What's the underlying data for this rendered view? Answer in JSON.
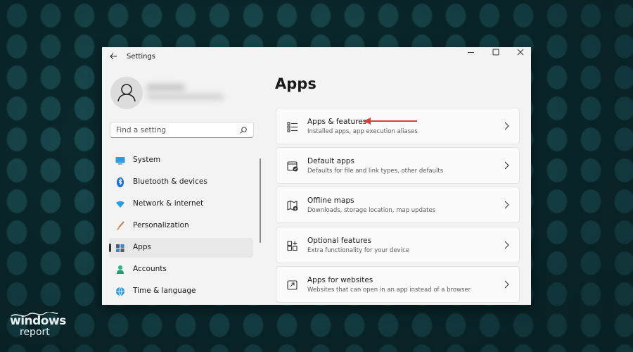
{
  "window": {
    "title": "Settings",
    "controls": {
      "minimize": "minimize-icon",
      "maximize": "maximize-icon",
      "close": "close-icon"
    }
  },
  "search": {
    "placeholder": "Find a setting"
  },
  "sidebar": {
    "items": [
      {
        "label": "System",
        "icon": "system-icon",
        "active": false
      },
      {
        "label": "Bluetooth & devices",
        "icon": "bluetooth-icon",
        "active": false
      },
      {
        "label": "Network & internet",
        "icon": "wifi-icon",
        "active": false
      },
      {
        "label": "Personalization",
        "icon": "brush-icon",
        "active": false
      },
      {
        "label": "Apps",
        "icon": "apps-icon",
        "active": true
      },
      {
        "label": "Accounts",
        "icon": "accounts-icon",
        "active": false
      },
      {
        "label": "Time & language",
        "icon": "globe-icon",
        "active": false
      }
    ]
  },
  "main": {
    "title": "Apps",
    "cards": [
      {
        "title": "Apps & features",
        "subtitle": "Installed apps, app execution aliases",
        "icon": "apps-list-icon"
      },
      {
        "title": "Default apps",
        "subtitle": "Defaults for file and link types, other defaults",
        "icon": "default-apps-icon"
      },
      {
        "title": "Offline maps",
        "subtitle": "Downloads, storage location, map updates",
        "icon": "map-icon"
      },
      {
        "title": "Optional features",
        "subtitle": "Extra functionality for your device",
        "icon": "optional-features-icon"
      },
      {
        "title": "Apps for websites",
        "subtitle": "Websites that can open in an app instead of a browser",
        "icon": "open-in-app-icon"
      }
    ]
  },
  "annotation": {
    "color": "#d9403a"
  },
  "brand": {
    "line1": "windows",
    "line2": "report"
  },
  "colors": {
    "accent": "#0067c0",
    "desktop": "#0b2b30"
  }
}
